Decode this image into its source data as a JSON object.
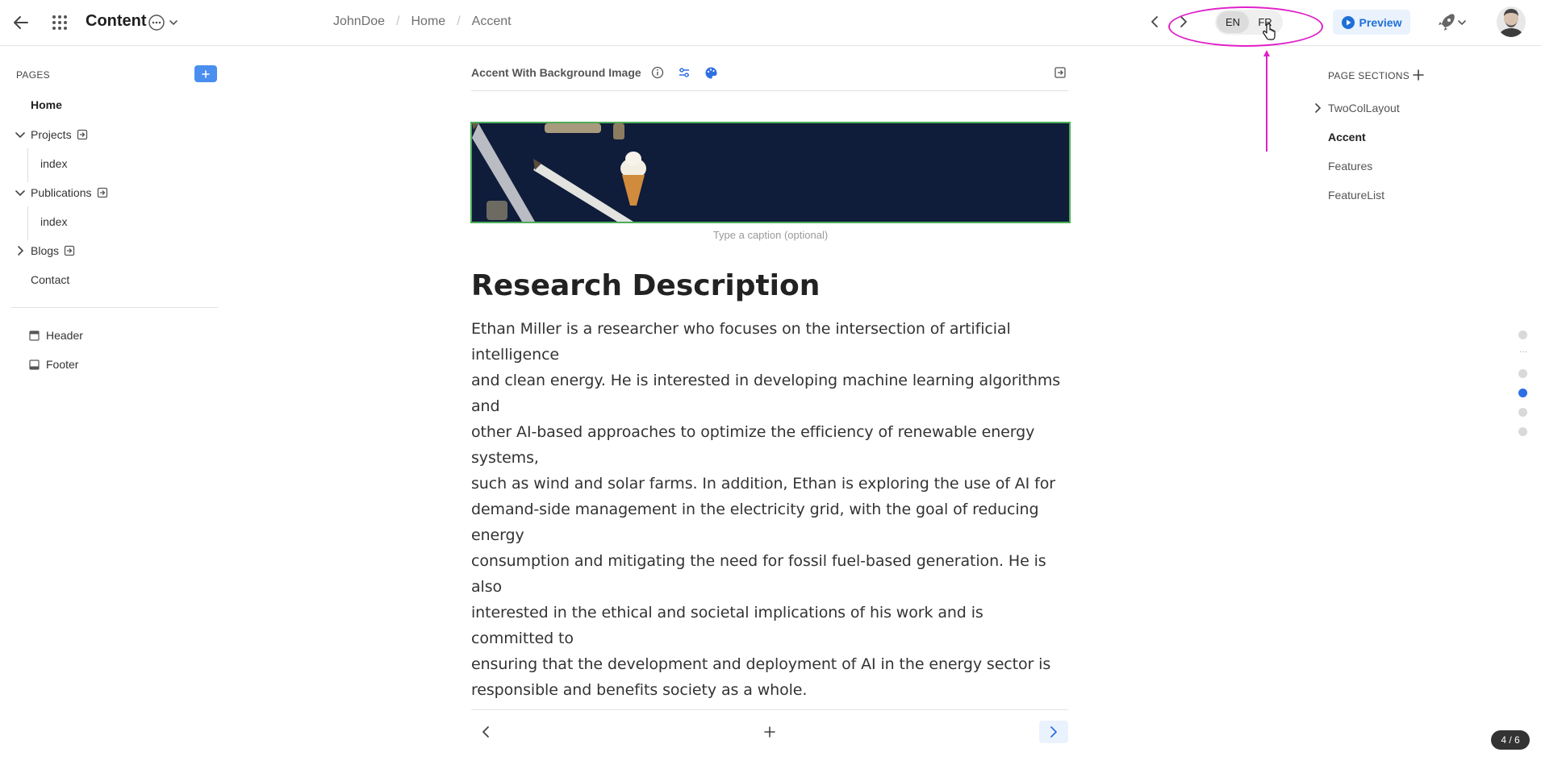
{
  "header": {
    "app_title": "Content",
    "breadcrumb": [
      "JohnDoe",
      "Home",
      "Accent"
    ],
    "languages": [
      "EN",
      "FR"
    ],
    "active_language": "EN",
    "preview_label": "Preview"
  },
  "sidebar": {
    "pages_label": "PAGES",
    "items": [
      {
        "label": "Home",
        "active": true
      },
      {
        "label": "Projects",
        "expanded": true
      },
      {
        "label": "index"
      },
      {
        "label": "Publications",
        "expanded": true
      },
      {
        "label": "index"
      },
      {
        "label": "Blogs",
        "expanded": false
      },
      {
        "label": "Contact"
      }
    ],
    "layout_items": [
      {
        "label": "Header"
      },
      {
        "label": "Footer"
      }
    ]
  },
  "editor": {
    "section_title": "Accent With Background Image",
    "caption_placeholder": "Type a caption (optional)",
    "heading": "Research Description",
    "body_lines": [
      "Ethan Miller is a researcher who focuses on the intersection of artificial intelligence",
      "and clean energy. He is interested in developing machine learning algorithms and",
      "other AI-based approaches to optimize the efficiency of renewable energy systems,",
      "such as wind and solar farms. In addition, Ethan is exploring the use of AI for",
      "demand-side management in the electricity grid, with the goal of reducing energy",
      "consumption and mitigating the need for fossil fuel-based generation. He is also",
      "interested in the ethical and societal implications of his work and is committed to",
      "ensuring that the development and deployment of AI in the energy sector is",
      "responsible and benefits society as a whole."
    ]
  },
  "page_sections": {
    "label": "PAGE SECTIONS",
    "items": [
      {
        "label": "TwoColLayout"
      },
      {
        "label": "Accent",
        "active": true
      },
      {
        "label": "Features"
      },
      {
        "label": "FeatureList"
      }
    ]
  },
  "pagination": {
    "counter": "4 / 6"
  },
  "colors": {
    "accent": "#2f6fe4",
    "annotation": "#e020c8",
    "selected_border": "#4cae58"
  }
}
